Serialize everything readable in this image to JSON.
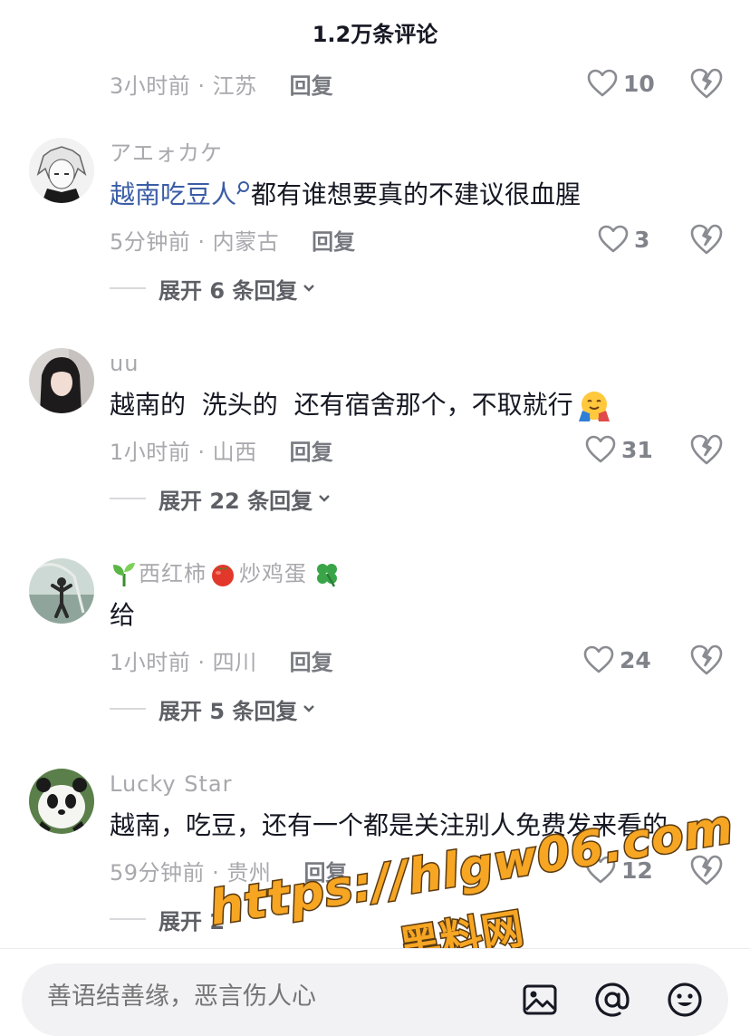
{
  "header": {
    "title": "1.2万条评论"
  },
  "comments": [
    {
      "meta": "3小时前 · 江苏",
      "reply": "回复",
      "likes": "10"
    },
    {
      "username": "アエォカケ",
      "mention": "越南吃豆人",
      "text": "都有谁想要真的不建议很血腥",
      "meta": "5分钟前 · 内蒙古",
      "reply": "回复",
      "likes": "3",
      "expand": "展开 6 条回复"
    },
    {
      "username": "uu",
      "text": "越南的  洗头的  还有宿舍那个，不取就行",
      "meta": "1小时前 · 山西",
      "reply": "回复",
      "likes": "31",
      "expand": "展开 22 条回复"
    },
    {
      "username_a": "西红柿",
      "username_b": "炒鸡蛋",
      "text": "给",
      "meta": "1小时前 · 四川",
      "reply": "回复",
      "likes": "24",
      "expand": "展开 5 条回复"
    },
    {
      "username": "Lucky  Star",
      "text": "越南，吃豆，还有一个都是关注别人免费发来看的",
      "meta": "59分钟前 · 贵州",
      "reply": "回复",
      "likes": "12",
      "expand": "展开 2"
    }
  ],
  "input": {
    "placeholder": "善语结善缘，恶言伤人心"
  },
  "icons": [
    "heart-icon",
    "dislike-heart-icon",
    "chevron-down-icon",
    "image-icon",
    "at-icon",
    "emoji-icon",
    "search-small-icon"
  ],
  "watermark": {
    "line1": "https://hlgw06.com",
    "line2": "黑料网"
  },
  "colors": {
    "mention": "#3b5da6",
    "meta": "#a8a8ad",
    "watermark": "#f6a623"
  }
}
